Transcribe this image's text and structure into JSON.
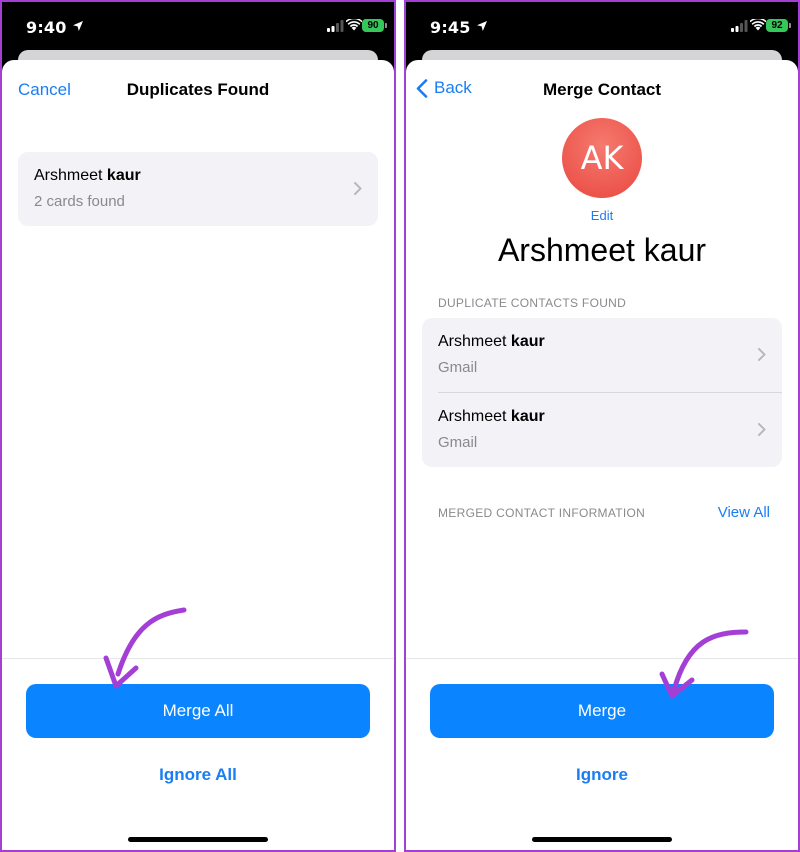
{
  "left": {
    "status": {
      "time": "9:40",
      "battery": "90"
    },
    "nav": {
      "cancel": "Cancel",
      "title": "Duplicates Found"
    },
    "card": {
      "first": "Arshmeet",
      "last": "kaur",
      "subtitle": "2 cards found"
    },
    "primary_button": "Merge All",
    "secondary_button": "Ignore All"
  },
  "right": {
    "status": {
      "time": "9:45",
      "battery": "92"
    },
    "nav": {
      "back": "Back",
      "title": "Merge Contact"
    },
    "avatar": {
      "initials": "AK",
      "edit": "Edit"
    },
    "name": "Arshmeet kaur",
    "duplicates_header": "DUPLICATE CONTACTS FOUND",
    "duplicates": [
      {
        "first": "Arshmeet",
        "last": "kaur",
        "source": "Gmail"
      },
      {
        "first": "Arshmeet",
        "last": "kaur",
        "source": "Gmail"
      }
    ],
    "merged_header": "MERGED CONTACT INFORMATION",
    "view_all": "View All",
    "primary_button": "Merge",
    "secondary_button": "Ignore"
  },
  "colors": {
    "accent": "#0a84ff",
    "link": "#1a7ef2",
    "annotation_arrow": "#a43fd6",
    "avatar": "#e9473f",
    "battery": "#35c759"
  },
  "icons": [
    "location-arrow-icon",
    "cellular-signal-icon",
    "wifi-icon",
    "battery-icon",
    "chevron-right-icon",
    "chevron-left-icon"
  ]
}
